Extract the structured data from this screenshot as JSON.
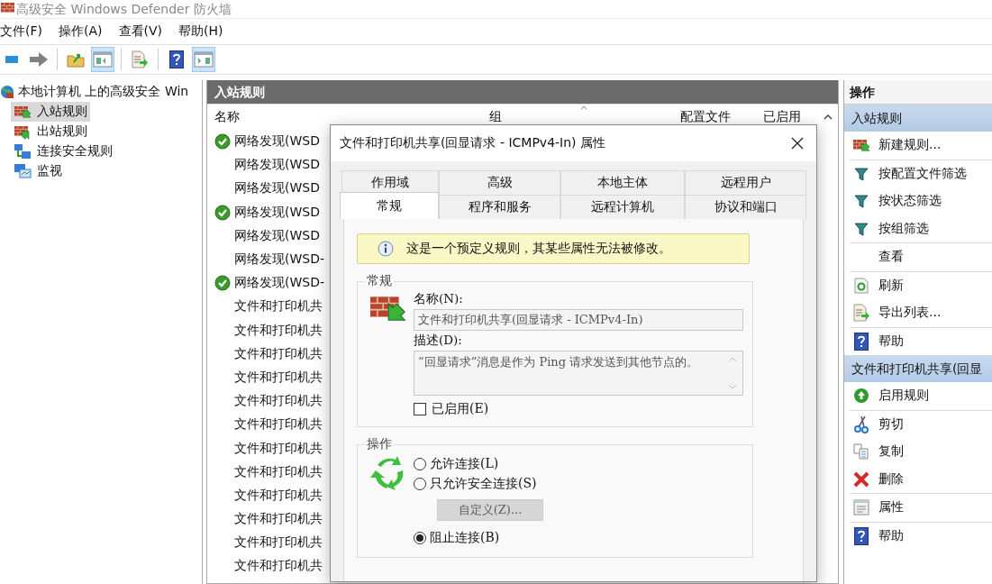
{
  "window": {
    "title": "高级安全 Windows Defender 防火墙"
  },
  "menu": [
    "文件(F)",
    "操作(A)",
    "查看(V)",
    "帮助(H)"
  ],
  "toolbar": {
    "items": [
      {
        "kind": "back",
        "pressed": false
      },
      {
        "kind": "forward",
        "pressed": false
      },
      {
        "kind": "separator"
      },
      {
        "kind": "up",
        "pressed": false
      },
      {
        "kind": "tree-toggle",
        "pressed": true
      },
      {
        "kind": "separator"
      },
      {
        "kind": "export",
        "pressed": false
      },
      {
        "kind": "separator"
      },
      {
        "kind": "help",
        "pressed": false
      },
      {
        "kind": "pane-toggle",
        "pressed": true
      }
    ]
  },
  "tree": {
    "label": "本地计算机 上的高级安全 Win",
    "children": [
      {
        "label": "入站规则",
        "kind": "inbound",
        "selected": true
      },
      {
        "label": "出站规则",
        "kind": "outbound",
        "selected": false
      },
      {
        "label": "连接安全规则",
        "kind": "connection",
        "selected": false
      },
      {
        "label": "监视",
        "kind": "monitor",
        "selected": false
      }
    ]
  },
  "rules": {
    "title": "入站规则",
    "columns": [
      "名称",
      "组",
      "配置文件",
      "已启用"
    ],
    "rows": [
      {
        "name": "网络发现(WSD",
        "enabled": true
      },
      {
        "name": "网络发现(WSD",
        "enabled": false
      },
      {
        "name": "网络发现(WSD",
        "enabled": false
      },
      {
        "name": "网络发现(WSD",
        "enabled": true
      },
      {
        "name": "网络发现(WSD",
        "enabled": false
      },
      {
        "name": "网络发现(WSD-",
        "enabled": false
      },
      {
        "name": "网络发现(WSD-",
        "enabled": true
      },
      {
        "name": "文件和打印机共",
        "enabled": false
      },
      {
        "name": "文件和打印机共",
        "enabled": false
      },
      {
        "name": "文件和打印机共",
        "enabled": false
      },
      {
        "name": "文件和打印机共",
        "enabled": false
      },
      {
        "name": "文件和打印机共",
        "enabled": false
      },
      {
        "name": "文件和打印机共",
        "enabled": false
      },
      {
        "name": "文件和打印机共",
        "enabled": false
      },
      {
        "name": "文件和打印机共",
        "enabled": false
      },
      {
        "name": "文件和打印机共",
        "enabled": false
      },
      {
        "name": "文件和打印机共",
        "enabled": false
      },
      {
        "name": "文件和打印机共",
        "enabled": false
      },
      {
        "name": "文件和打印机共",
        "enabled": false
      }
    ]
  },
  "actions": {
    "title": "操作",
    "sections": [
      {
        "title": "入站规则",
        "items": [
          {
            "label": "新建规则...",
            "kind": "new-rule"
          },
          {
            "kind": "separator"
          },
          {
            "label": "按配置文件筛选",
            "kind": "filter"
          },
          {
            "label": "按状态筛选",
            "kind": "filter"
          },
          {
            "label": "按组筛选",
            "kind": "filter"
          },
          {
            "kind": "separator"
          },
          {
            "label": "查看",
            "kind": "none"
          },
          {
            "kind": "separator"
          },
          {
            "label": "刷新",
            "kind": "refresh"
          },
          {
            "label": "导出列表...",
            "kind": "export"
          },
          {
            "kind": "separator"
          },
          {
            "label": "帮助",
            "kind": "help"
          }
        ]
      },
      {
        "title": "文件和打印机共享(回显",
        "items": [
          {
            "label": "启用规则",
            "kind": "enable"
          },
          {
            "kind": "separator"
          },
          {
            "label": "剪切",
            "kind": "cut"
          },
          {
            "label": "复制",
            "kind": "copy"
          },
          {
            "label": "删除",
            "kind": "delete"
          },
          {
            "kind": "separator"
          },
          {
            "label": "属性",
            "kind": "properties"
          },
          {
            "kind": "separator"
          },
          {
            "label": "帮助",
            "kind": "help"
          }
        ]
      }
    ]
  },
  "dialog": {
    "title": "文件和打印机共享(回显请求 - ICMPv4-In) 属性",
    "tab_rows": [
      [
        {
          "label": "作用域",
          "selected": false
        },
        {
          "label": "高级",
          "selected": false
        },
        {
          "label": "本地主体",
          "selected": false
        },
        {
          "label": "远程用户",
          "selected": false
        }
      ],
      [
        {
          "label": "常规",
          "selected": true
        },
        {
          "label": "程序和服务",
          "selected": false
        },
        {
          "label": "远程计算机",
          "selected": false
        },
        {
          "label": "协议和端口",
          "selected": false
        }
      ]
    ],
    "notice": "这是一个预定义规则，其某些属性无法被修改。",
    "general": {
      "title": "常规",
      "name_label": "名称(N):",
      "name_value": "文件和打印机共享(回显请求 - ICMPv4-In)",
      "description_label": "描述(D):",
      "description": "“回显请求”消息是作为 Ping 请求发送到其他节点的。",
      "enabled_label": "已启用(E)",
      "enabled": false
    },
    "action": {
      "title": "操作",
      "options": [
        {
          "kind": "radio",
          "label": "允许连接(L)",
          "selected": false
        },
        {
          "kind": "radio",
          "label": "只允许安全连接(S)",
          "selected": false
        },
        {
          "kind": "button",
          "label": "自定义(Z)...",
          "disabled": true
        },
        {
          "kind": "radio",
          "label": "阻止连接(B)",
          "selected": true
        }
      ]
    }
  }
}
